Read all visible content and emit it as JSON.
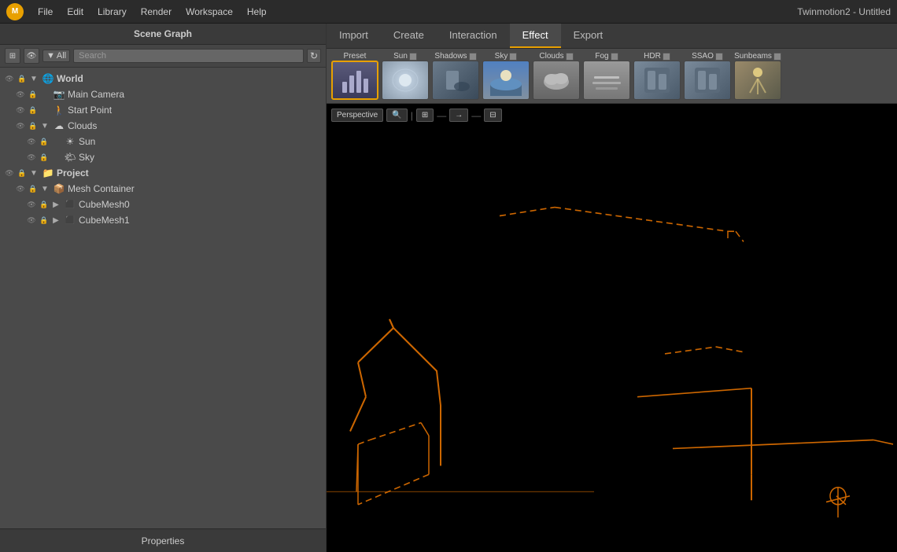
{
  "titlebar": {
    "logo": "M",
    "menu_items": [
      "File",
      "Edit",
      "Library",
      "Render",
      "Workspace",
      "Help"
    ],
    "app_title": "Twinmotion2 - Untitled"
  },
  "left_panel": {
    "scene_graph_label": "Scene Graph",
    "toolbar": {
      "all_label": "All",
      "search_placeholder": "Search",
      "refresh_icon": "↻"
    },
    "tree": [
      {
        "id": "world",
        "label": "World",
        "indent": 0,
        "icon": "🌐",
        "expand": "▼",
        "bold": true
      },
      {
        "id": "main-camera",
        "label": "Main Camera",
        "indent": 1,
        "icon": "📷",
        "expand": ""
      },
      {
        "id": "start-point",
        "label": "Start Point",
        "indent": 1,
        "icon": "🚶",
        "expand": ""
      },
      {
        "id": "clouds",
        "label": "Clouds",
        "indent": 1,
        "icon": "☁",
        "expand": "▼"
      },
      {
        "id": "sun",
        "label": "Sun",
        "indent": 2,
        "icon": "☀",
        "expand": ""
      },
      {
        "id": "sky",
        "label": "Sky",
        "indent": 2,
        "icon": "🌤",
        "expand": ""
      },
      {
        "id": "project",
        "label": "Project",
        "indent": 0,
        "icon": "📁",
        "expand": "▼",
        "bold": true
      },
      {
        "id": "mesh-container",
        "label": "Mesh Container",
        "indent": 1,
        "icon": "📦",
        "expand": "▼"
      },
      {
        "id": "cubemesh0",
        "label": "CubeMesh0",
        "indent": 2,
        "icon": "⬛",
        "expand": "▶"
      },
      {
        "id": "cubemesh1",
        "label": "CubeMesh1",
        "indent": 2,
        "icon": "⬛",
        "expand": "▶"
      }
    ],
    "properties_label": "Properties"
  },
  "tabs": [
    "Import",
    "Create",
    "Interaction",
    "Effect",
    "Export"
  ],
  "active_tab": "Effect",
  "effect_bar": {
    "items": [
      {
        "id": "preset",
        "label": "Preset",
        "checked": false,
        "thumb_class": "preset-thumb",
        "active": true
      },
      {
        "id": "sun",
        "label": "Sun",
        "checked": true,
        "thumb_class": "sun-thumb",
        "active": false
      },
      {
        "id": "shadows",
        "label": "Shadows",
        "checked": true,
        "thumb_class": "shadows-thumb",
        "active": false
      },
      {
        "id": "sky",
        "label": "Sky",
        "checked": true,
        "thumb_class": "sky-thumb",
        "active": false
      },
      {
        "id": "clouds",
        "label": "Clouds",
        "checked": true,
        "thumb_class": "clouds-thumb",
        "active": false
      },
      {
        "id": "fog",
        "label": "Fog",
        "checked": true,
        "thumb_class": "fog-thumb",
        "active": false
      },
      {
        "id": "hdr",
        "label": "HDR",
        "checked": true,
        "thumb_class": "hdr-thumb",
        "active": false
      },
      {
        "id": "ssao",
        "label": "SSAO",
        "checked": true,
        "thumb_class": "ssao-thumb",
        "active": false
      },
      {
        "id": "sunbeams",
        "label": "Sunbeams",
        "checked": true,
        "thumb_class": "sunbeams-thumb",
        "active": false
      }
    ]
  },
  "viewport": {
    "perspective_label": "Perspective",
    "controls": [
      "🔍",
      "⊞",
      "→",
      "⊟"
    ]
  },
  "colors": {
    "accent": "#e8a000",
    "wireframe": "#cc6600",
    "wireframe_dashed": "#cc6600"
  }
}
